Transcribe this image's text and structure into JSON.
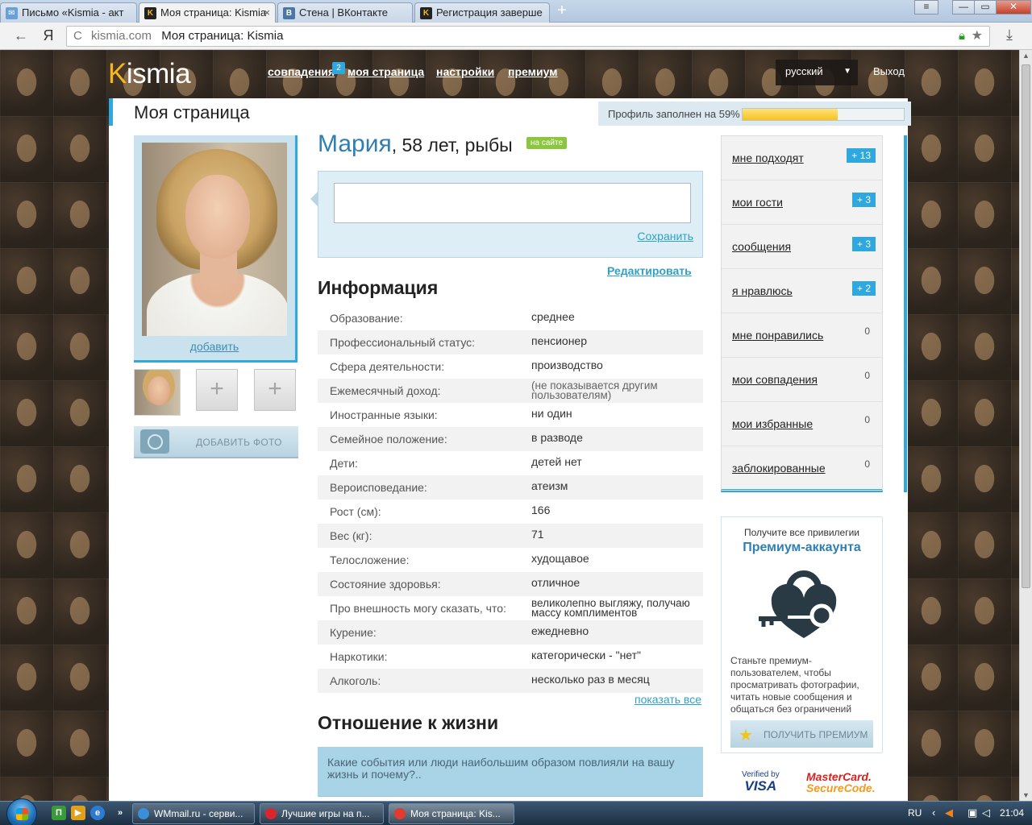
{
  "browser": {
    "tabs": [
      {
        "label": "Письмо «Kismia - акт",
        "favicon": "mail-icon",
        "favcolor": "#6aa0d8",
        "active": false
      },
      {
        "label": "Моя страница: Kismia",
        "favicon": "kismia-icon",
        "favcolor": "#222",
        "active": true,
        "close": "×"
      },
      {
        "label": "Стена | ВКонтакте",
        "favicon": "vk-icon",
        "favcolor": "#4a76a8",
        "active": false
      },
      {
        "label": "Регистрация заверше",
        "favicon": "kismia-icon",
        "favcolor": "#222",
        "active": false
      }
    ],
    "new_tab": "+",
    "back": "←",
    "yandex": "Я",
    "reload": "C",
    "url_domain": "kismia.com",
    "url_title": "Моя страница: Kismia",
    "window_controls": {
      "menu": "≡",
      "minimize": "—",
      "maximize": "▭",
      "close": "✕"
    }
  },
  "site": {
    "logo_k": "K",
    "logo_rest": "ismia",
    "nav": {
      "matches": "совпадения",
      "matches_badge": "2",
      "my_page": "моя страница",
      "settings": "настройки",
      "premium": "премиум"
    },
    "language": "русский",
    "logout": "Выход"
  },
  "page": {
    "title": "Моя страница",
    "profile_fill_text": "Профиль заполнен на 59%",
    "profile_fill_percent": 59
  },
  "profile": {
    "name": "Мария",
    "age_sign": ", 58 лет, рыбы",
    "online_badge": "на сайте",
    "add_photo_link": "добавить",
    "add_photo_button": "ДОБАВИТЬ ФОТО",
    "plus": "+",
    "save": "Сохранить",
    "edit": "Редактировать"
  },
  "info": {
    "heading": "Информация",
    "rows": [
      {
        "k": "Образование:",
        "v": "среднее"
      },
      {
        "k": "Профессиональный статус:",
        "v": "пенсионер"
      },
      {
        "k": "Сфера деятельности:",
        "v": "производство"
      },
      {
        "k": "Ежемесячный доход:",
        "v": "(не показывается другим пользователям)"
      },
      {
        "k": "Иностранные языки:",
        "v": "ни один"
      },
      {
        "k": "Семейное положение:",
        "v": "в разводе"
      },
      {
        "k": "Дети:",
        "v": "детей нет"
      },
      {
        "k": "Вероисповедание:",
        "v": "атеизм"
      },
      {
        "k": "Рост (см):",
        "v": "166"
      },
      {
        "k": "Вес (кг):",
        "v": "71"
      },
      {
        "k": "Телосложение:",
        "v": "худощавое"
      },
      {
        "k": "Состояние здоровья:",
        "v": "отличное"
      },
      {
        "k": "Про внешность могу сказать, что:",
        "v": "великолепно выгляжу, получаю массу комплиментов"
      },
      {
        "k": "Курение:",
        "v": "ежедневно"
      },
      {
        "k": "Наркотики:",
        "v": "категорически - \"нет\""
      },
      {
        "k": "Алкоголь:",
        "v": "несколько раз в месяц"
      }
    ],
    "show_all": "показать все"
  },
  "life": {
    "heading": "Отношение к жизни",
    "question": "Какие события или люди наибольшим образом повлияли на вашу жизнь и почему?.."
  },
  "sidebar": {
    "items": [
      {
        "label": "мне подходят",
        "count": "+ 13",
        "new": true
      },
      {
        "label": "мои гости",
        "count": "+ 3",
        "new": true
      },
      {
        "label": "сообщения",
        "count": "+ 3",
        "new": true
      },
      {
        "label": "я нравлюсь",
        "count": "+ 2",
        "new": true
      },
      {
        "label": "мне понравились",
        "count": "0",
        "new": false
      },
      {
        "label": "мои совпадения",
        "count": "0",
        "new": false
      },
      {
        "label": "мои избранные",
        "count": "0",
        "new": false
      },
      {
        "label": "заблокированные",
        "count": "0",
        "new": false
      }
    ]
  },
  "premium": {
    "line1": "Получите все привилегии",
    "line2": "Премиум-аккаунта",
    "text": "Станьте премиум-пользователем, чтобы просматривать фотографии, читать новые сообщения и общаться без ограничений",
    "button": "ПОЛУЧИТЬ ПРЕМИУМ",
    "icon": "heart-lock-key-icon"
  },
  "payments": {
    "visa_top": "Verified by",
    "visa_bottom": "VISA",
    "mc_top": "MasterCard.",
    "mc_bottom": "SecureCode."
  },
  "taskbar": {
    "buttons": [
      {
        "label": "WMmail.ru - серви...",
        "icon": "ie-icon",
        "color": "#3b8fd8"
      },
      {
        "label": "Лучшие игры на п...",
        "icon": "opera-icon",
        "color": "#d8262c"
      },
      {
        "label": "Моя страница: Kis...",
        "icon": "yandex-icon",
        "color": "#e23a2e"
      }
    ],
    "overflow": "»",
    "lang": "RU",
    "time": "21:04"
  }
}
